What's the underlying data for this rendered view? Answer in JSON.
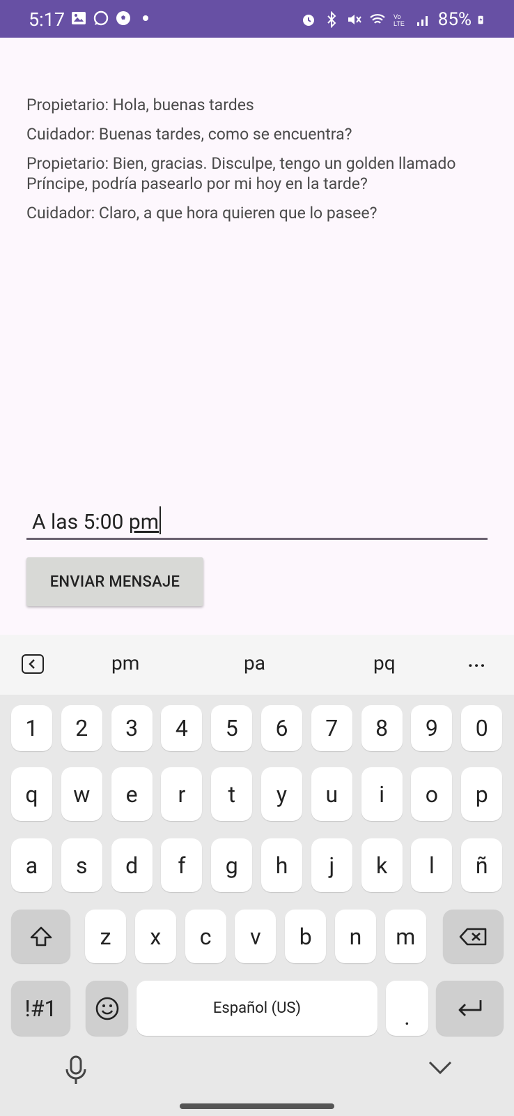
{
  "status_bar": {
    "time": "5:17",
    "battery": "85%",
    "background": "#6750a4"
  },
  "chat": {
    "messages": [
      "Propietario: Hola, buenas tardes",
      "Cuidador: Buenas tardes, como se encuentra?",
      "Propietario: Bien, gracias. Disculpe, tengo un golden llamado Príncipe, podría pasearlo por mi hoy en la tarde?",
      "Cuidador: Claro, a que hora quieren que lo pasee?"
    ]
  },
  "input": {
    "value_prefix": "A las 5:00 ",
    "value_composing": "pm"
  },
  "send_button": {
    "label": "ENVIAR MENSAJE"
  },
  "keyboard": {
    "suggestions": [
      "pm",
      "pa",
      "pq"
    ],
    "more": "···",
    "numbers": [
      "1",
      "2",
      "3",
      "4",
      "5",
      "6",
      "7",
      "8",
      "9",
      "0"
    ],
    "row1": [
      "q",
      "w",
      "e",
      "r",
      "t",
      "y",
      "u",
      "i",
      "o",
      "p"
    ],
    "row2": [
      "a",
      "s",
      "d",
      "f",
      "g",
      "h",
      "j",
      "k",
      "l",
      "ñ"
    ],
    "row3": [
      "z",
      "x",
      "c",
      "v",
      "b",
      "n",
      "m"
    ],
    "symbols_label": "!#1",
    "space_label": "Español (US)",
    "period_label": "."
  }
}
